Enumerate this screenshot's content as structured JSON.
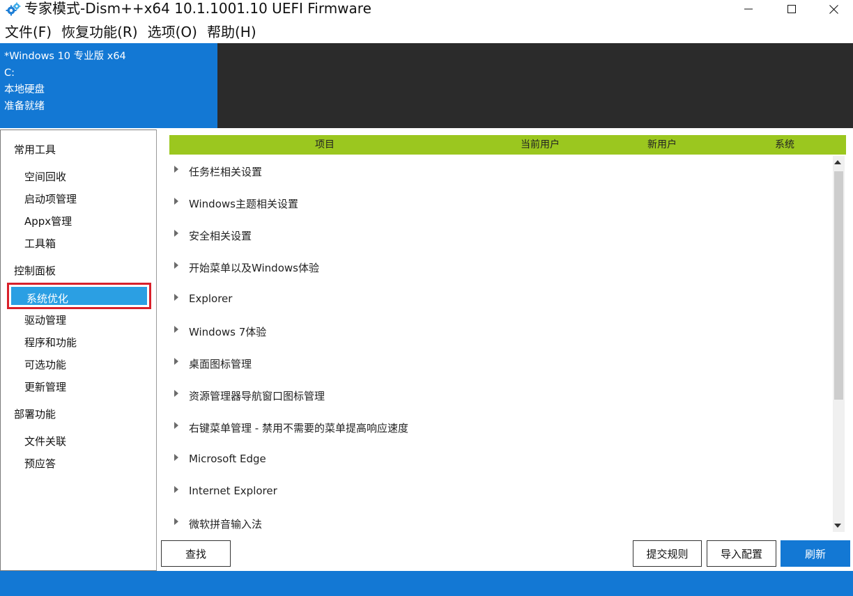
{
  "window": {
    "title": "专家模式-Dism++x64 10.1.1001.10 UEFI Firmware",
    "icon": "gear-icon",
    "controls": [
      "minimize-icon",
      "maximize-icon",
      "close-icon"
    ]
  },
  "menu": {
    "items": [
      "文件(F)",
      "恢复功能(R)",
      "选项(O)",
      "帮助(H)"
    ]
  },
  "header": {
    "os": "*Windows 10 专业版 x64",
    "drive": "C:",
    "disk_type": "本地硬盘",
    "status": "准备就绪",
    "accent_color": "#1378d4"
  },
  "sidebar": {
    "sections": [
      {
        "title": "常用工具",
        "items": [
          "空间回收",
          "启动项管理",
          "Appx管理",
          "工具箱"
        ]
      },
      {
        "title": "控制面板",
        "items": [
          "系统优化",
          "驱动管理",
          "程序和功能",
          "可选功能",
          "更新管理"
        ]
      },
      {
        "title": "部署功能",
        "items": [
          "文件关联",
          "预应答"
        ]
      }
    ],
    "selected": "系统优化"
  },
  "table": {
    "header_color": "#9bc71f",
    "columns": [
      "项目",
      "当前用户",
      "新用户",
      "系统"
    ],
    "rows": [
      "任务栏相关设置",
      "Windows主题相关设置",
      "安全相关设置",
      "开始菜单以及Windows体验",
      "Explorer",
      "Windows 7体验",
      "桌面图标管理",
      "资源管理器导航窗口图标管理",
      "右键菜单管理 - 禁用不需要的菜单提高响应速度",
      "Microsoft Edge",
      "Internet Explorer",
      "微软拼音输入法"
    ]
  },
  "buttons": {
    "find": "查找",
    "submit_rules": "提交规则",
    "import_config": "导入配置",
    "refresh": "刷新"
  }
}
